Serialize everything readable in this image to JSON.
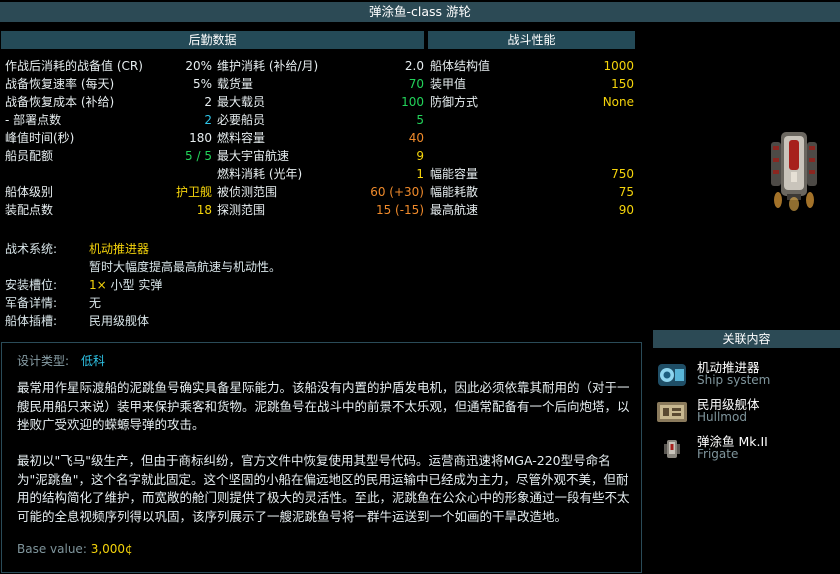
{
  "title": "弹涂鱼-class 游轮",
  "logistics": {
    "header": "后勤数据",
    "col1": [
      {
        "label": "作战后消耗的战备值 (CR)",
        "value": "20%",
        "color": "w"
      },
      {
        "label": "战备恢复速率 (每天)",
        "value": "5%",
        "color": "w"
      },
      {
        "label": "战备恢复成本 (补给)",
        "value": "2",
        "color": "w"
      },
      {
        "label": "- 部署点数",
        "value": "2",
        "color": "c"
      },
      {
        "label": "峰值时间(秒)",
        "value": "180",
        "color": "w"
      },
      {
        "label": "船员配额",
        "value": "5 / 5",
        "color": "g"
      },
      {
        "label": "",
        "value": "",
        "color": "w"
      },
      {
        "label": "船体级别",
        "value": "护卫舰",
        "color": "y"
      },
      {
        "label": "装配点数",
        "value": "18",
        "color": "y"
      }
    ],
    "col2": [
      {
        "label": "维护消耗 (补给/月)",
        "value": "2.0",
        "color": "w"
      },
      {
        "label": "载货量",
        "value": "70",
        "color": "g"
      },
      {
        "label": "最大载员",
        "value": "100",
        "color": "g"
      },
      {
        "label": "必要船员",
        "value": "5",
        "color": "g"
      },
      {
        "label": "燃料容量",
        "value": "40",
        "color": "o"
      },
      {
        "label": "最大宇宙航速",
        "value": "9",
        "color": "y"
      },
      {
        "label": "燃料消耗 (光年)",
        "value": "1",
        "color": "y"
      },
      {
        "label": "被侦测范围",
        "value": "60 (+30)",
        "color": "o"
      },
      {
        "label": "探测范围",
        "value": "15 (-15)",
        "color": "o"
      }
    ]
  },
  "combat": {
    "header": "战斗性能",
    "rows": [
      {
        "label": "船体结构值",
        "value": "1000",
        "color": "y"
      },
      {
        "label": "装甲值",
        "value": "150",
        "color": "y"
      },
      {
        "label": "防御方式",
        "value": "None",
        "color": "y"
      },
      {
        "label": "",
        "value": "",
        "color": "w"
      },
      {
        "label": "",
        "value": "",
        "color": "w"
      },
      {
        "label": "",
        "value": "",
        "color": "w"
      },
      {
        "label": "幅能容量",
        "value": "750",
        "color": "y"
      },
      {
        "label": "幅能耗散",
        "value": "75",
        "color": "y"
      },
      {
        "label": "最高航速",
        "value": "90",
        "color": "y"
      }
    ]
  },
  "system": {
    "label": "战术系统:",
    "name": "机动推进器",
    "desc": "暂时大幅度提高最高航速与机动性。",
    "mounts_label": "安装槽位:",
    "mounts_value": "1× 小型 实弹",
    "military_label": "军备详情:",
    "military_value": "无",
    "hullmod_label": "船体插槽:",
    "hullmod_value": "民用级舰体"
  },
  "description": {
    "design_type_label": "设计类型:",
    "design_type_value": "低科",
    "para1": "最常用作星际渡船的泥跳鱼号确实具备星际能力。该船没有内置的护盾发电机，因此必须依靠其耐用的（对于一艘民用船只来说）装甲来保护乘客和货物。泥跳鱼号在战斗中的前景不太乐观，但通常配备有一个后向炮塔，以挫败广受欢迎的蝾螈导弹的攻击。",
    "para2": "最初以\"飞马\"级生产，但由于商标纠纷，官方文件中恢复使用其型号代码。运营商迅速将MGA-220型号命名为\"泥跳鱼\"，这个名字就此固定。这个坚固的小船在偏远地区的民用运输中已经成为主力，尽管外观不美，但耐用的结构简化了维护，而宽敞的舱门则提供了极大的灵活性。至此，泥跳鱼在公众心中的形象通过一段有些不太可能的全息视频序列得以巩固，该序列展示了一艘泥跳鱼号将一群牛运送到一个如画的干旱改造地。",
    "base_label": "Base value:",
    "base_value": "3,000¢"
  },
  "related": {
    "header": "关联内容",
    "items": [
      {
        "title": "机动推进器",
        "subtitle": "Ship system",
        "icon": "thruster-icon"
      },
      {
        "title": "民用级舰体",
        "subtitle": "Hullmod",
        "icon": "hullmod-icon"
      },
      {
        "title": "弹涂鱼 Mk.II",
        "subtitle": "Frigate",
        "icon": "ship-icon"
      }
    ]
  },
  "colors": {
    "yellow": "#f5d40b",
    "green": "#22d35a",
    "orange": "#ef8a2b",
    "cyan": "#2ec3e6",
    "header_bg": "#244a57"
  }
}
